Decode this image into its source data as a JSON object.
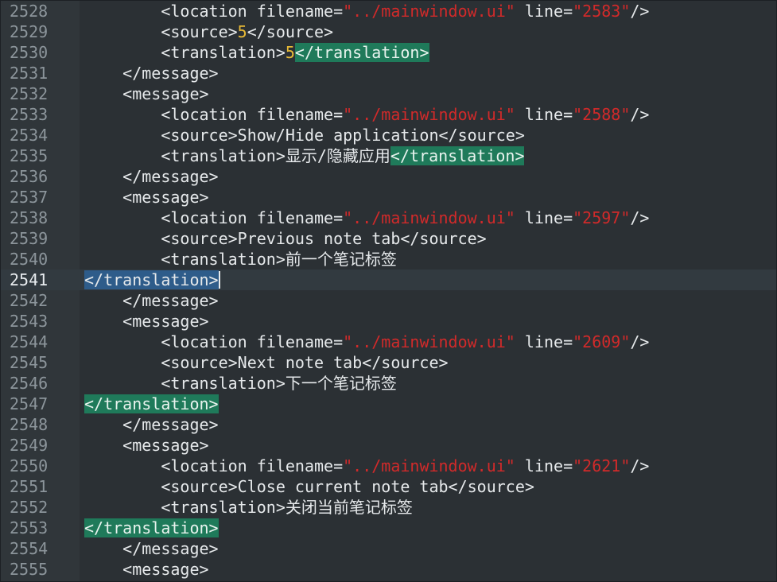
{
  "lines": [
    {
      "num": "2528",
      "indent": "        ",
      "segs": [
        {
          "t": "<location filename=",
          "c": ""
        },
        {
          "t": "\"../mainwindow.ui\"",
          "c": "str"
        },
        {
          "t": " line=",
          "c": ""
        },
        {
          "t": "\"2583\"",
          "c": "str"
        },
        {
          "t": "/>",
          "c": ""
        }
      ]
    },
    {
      "num": "2529",
      "indent": "        ",
      "segs": [
        {
          "t": "<source>",
          "c": ""
        },
        {
          "t": "5",
          "c": "num"
        },
        {
          "t": "</source>",
          "c": ""
        }
      ]
    },
    {
      "num": "2530",
      "indent": "        ",
      "segs": [
        {
          "t": "<translation>",
          "c": ""
        },
        {
          "t": "5",
          "c": "num"
        },
        {
          "t": "</translation>",
          "c": "hl"
        }
      ]
    },
    {
      "num": "2531",
      "indent": "    ",
      "segs": [
        {
          "t": "</message>",
          "c": ""
        }
      ]
    },
    {
      "num": "2532",
      "indent": "    ",
      "segs": [
        {
          "t": "<message>",
          "c": ""
        }
      ]
    },
    {
      "num": "2533",
      "indent": "        ",
      "segs": [
        {
          "t": "<location filename=",
          "c": ""
        },
        {
          "t": "\"../mainwindow.ui\"",
          "c": "str"
        },
        {
          "t": " line=",
          "c": ""
        },
        {
          "t": "\"2588\"",
          "c": "str"
        },
        {
          "t": "/>",
          "c": ""
        }
      ]
    },
    {
      "num": "2534",
      "indent": "        ",
      "segs": [
        {
          "t": "<source>Show/Hide application</source>",
          "c": ""
        }
      ]
    },
    {
      "num": "2535",
      "indent": "        ",
      "segs": [
        {
          "t": "<translation>显示/隐藏应用",
          "c": ""
        },
        {
          "t": "</translation>",
          "c": "hl"
        }
      ]
    },
    {
      "num": "2536",
      "indent": "    ",
      "segs": [
        {
          "t": "</message>",
          "c": ""
        }
      ]
    },
    {
      "num": "2537",
      "indent": "    ",
      "segs": [
        {
          "t": "<message>",
          "c": ""
        }
      ]
    },
    {
      "num": "2538",
      "indent": "        ",
      "segs": [
        {
          "t": "<location filename=",
          "c": ""
        },
        {
          "t": "\"../mainwindow.ui\"",
          "c": "str"
        },
        {
          "t": " line=",
          "c": ""
        },
        {
          "t": "\"2597\"",
          "c": "str"
        },
        {
          "t": "/>",
          "c": ""
        }
      ]
    },
    {
      "num": "2539",
      "indent": "        ",
      "segs": [
        {
          "t": "<source>Previous note tab</source>",
          "c": ""
        }
      ]
    },
    {
      "num": "2540",
      "indent": "        ",
      "segs": [
        {
          "t": "<translation>前一个笔记标签",
          "c": ""
        }
      ]
    },
    {
      "num": "2541",
      "indent": "",
      "current": true,
      "caret": true,
      "segs": [
        {
          "t": "</translation>",
          "c": "sel"
        }
      ]
    },
    {
      "num": "2542",
      "indent": "    ",
      "segs": [
        {
          "t": "</message>",
          "c": ""
        }
      ]
    },
    {
      "num": "2543",
      "indent": "    ",
      "segs": [
        {
          "t": "<message>",
          "c": ""
        }
      ]
    },
    {
      "num": "2544",
      "indent": "        ",
      "segs": [
        {
          "t": "<location filename=",
          "c": ""
        },
        {
          "t": "\"../mainwindow.ui\"",
          "c": "str"
        },
        {
          "t": " line=",
          "c": ""
        },
        {
          "t": "\"2609\"",
          "c": "str"
        },
        {
          "t": "/>",
          "c": ""
        }
      ]
    },
    {
      "num": "2545",
      "indent": "        ",
      "segs": [
        {
          "t": "<source>Next note tab</source>",
          "c": ""
        }
      ]
    },
    {
      "num": "2546",
      "indent": "        ",
      "segs": [
        {
          "t": "<translation>下一个笔记标签",
          "c": ""
        }
      ]
    },
    {
      "num": "2547",
      "indent": "",
      "segs": [
        {
          "t": "</translation>",
          "c": "hl"
        }
      ]
    },
    {
      "num": "2548",
      "indent": "    ",
      "segs": [
        {
          "t": "</message>",
          "c": ""
        }
      ]
    },
    {
      "num": "2549",
      "indent": "    ",
      "segs": [
        {
          "t": "<message>",
          "c": ""
        }
      ]
    },
    {
      "num": "2550",
      "indent": "        ",
      "segs": [
        {
          "t": "<location filename=",
          "c": ""
        },
        {
          "t": "\"../mainwindow.ui\"",
          "c": "str"
        },
        {
          "t": " line=",
          "c": ""
        },
        {
          "t": "\"2621\"",
          "c": "str"
        },
        {
          "t": "/>",
          "c": ""
        }
      ]
    },
    {
      "num": "2551",
      "indent": "        ",
      "segs": [
        {
          "t": "<source>Close current note tab</source>",
          "c": ""
        }
      ]
    },
    {
      "num": "2552",
      "indent": "        ",
      "segs": [
        {
          "t": "<translation>关闭当前笔记标签",
          "c": ""
        }
      ]
    },
    {
      "num": "2553",
      "indent": "",
      "segs": [
        {
          "t": "</translation>",
          "c": "hl"
        }
      ]
    },
    {
      "num": "2554",
      "indent": "    ",
      "segs": [
        {
          "t": "</message>",
          "c": ""
        }
      ]
    },
    {
      "num": "2555",
      "indent": "    ",
      "segs": [
        {
          "t": "<message>",
          "c": ""
        }
      ]
    }
  ]
}
